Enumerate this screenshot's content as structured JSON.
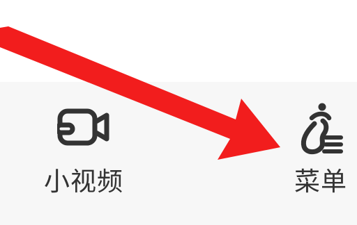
{
  "tabs": [
    {
      "label": "小视频",
      "icon": "video-camera-icon"
    },
    {
      "label": "菜单",
      "icon": "menu-figure-icon"
    }
  ],
  "annotation": {
    "type": "arrow",
    "color": "#f21d1d"
  },
  "colors": {
    "tab_bar_bg": "#f7f7f7",
    "icon": "#333333",
    "label": "#333333"
  }
}
